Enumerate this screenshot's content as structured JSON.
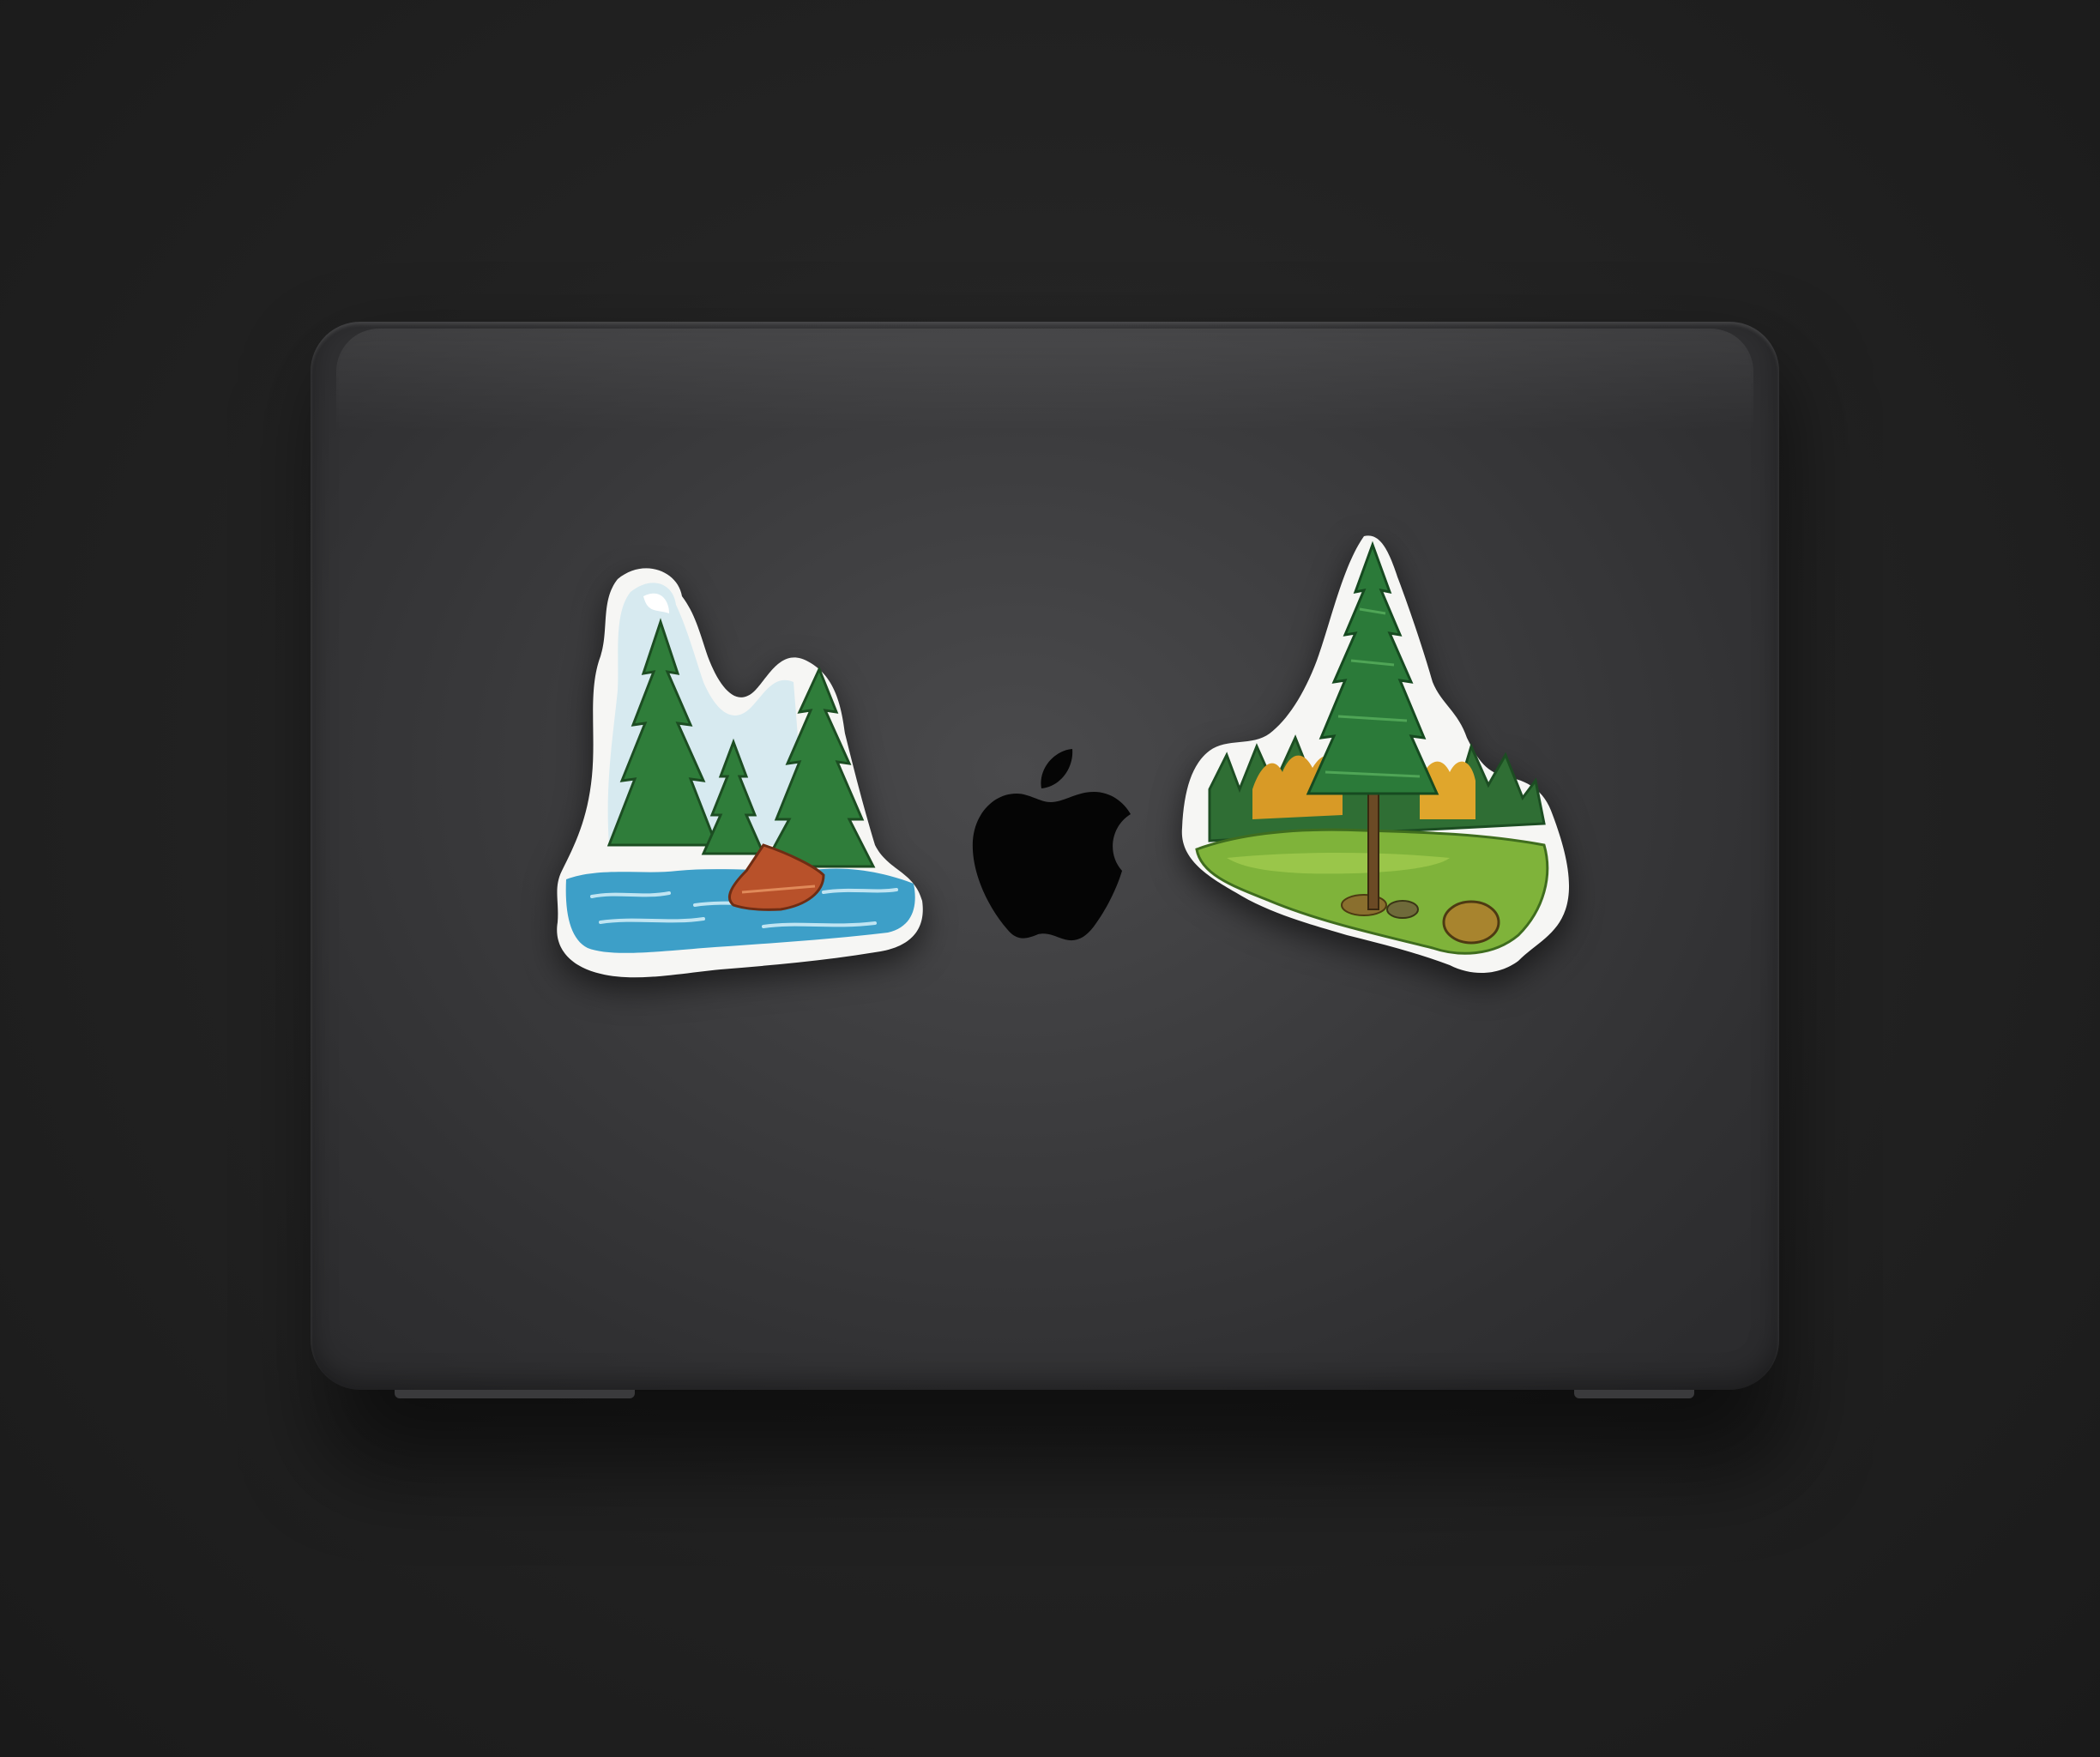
{
  "scene": {
    "background_color": "#232323",
    "laptop_color": "#3c3c3e",
    "logo_icon": "apple-logo-icon"
  },
  "stickers": [
    {
      "subject": "lake-with-pine-trees-and-boat",
      "colors": {
        "water": "#3d9fc8",
        "trees": "#2f7d3a",
        "boat": "#b8512a",
        "sky": "#d7eaf0"
      }
    },
    {
      "subject": "tall-pine-tree-in-forest-meadow",
      "colors": {
        "tree": "#2b7a39",
        "autumn": "#d89a26",
        "meadow": "#7fb33a"
      }
    }
  ]
}
